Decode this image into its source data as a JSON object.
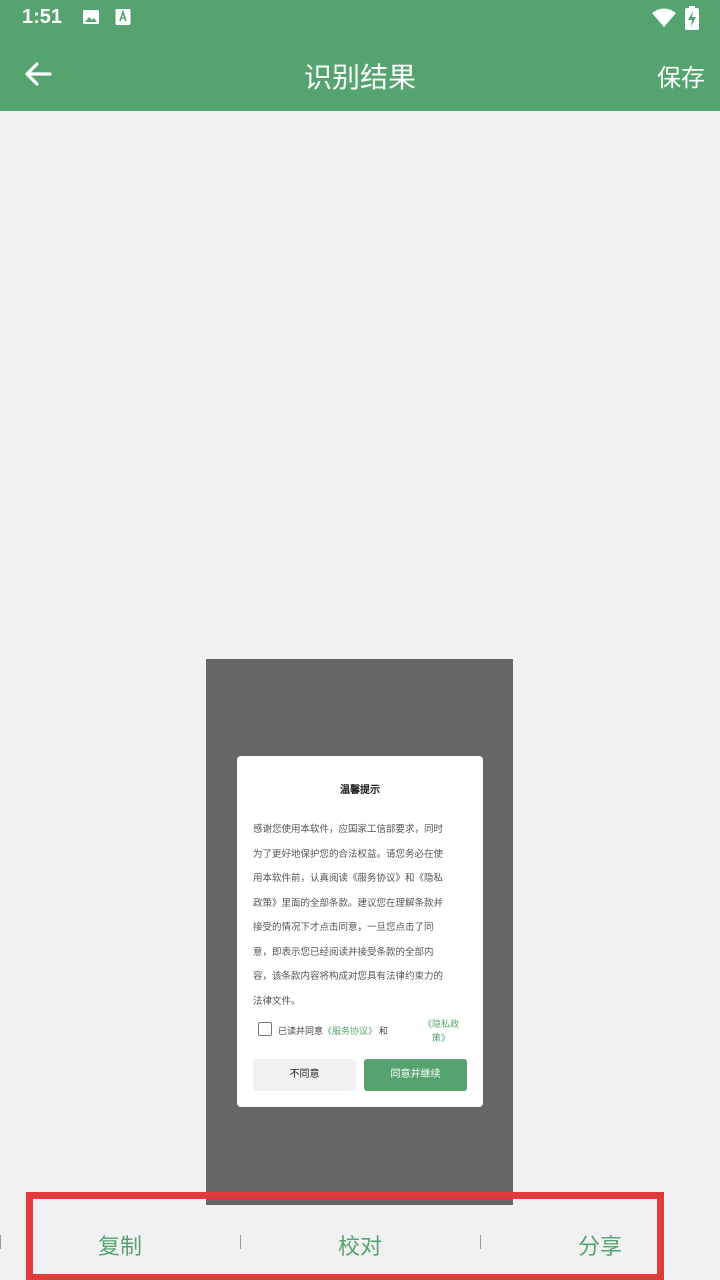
{
  "status_bar": {
    "time": "1:51",
    "icons": [
      "image-icon",
      "a-text-icon",
      "wifi-icon",
      "battery-charging-icon"
    ]
  },
  "app_bar": {
    "title": "识别结果",
    "save_label": "保存",
    "back_icon": "back-arrow-icon"
  },
  "preview_dialog": {
    "title": "温馨提示",
    "body_lines": [
      "感谢您使用本软件，应国家工信部要求，同时",
      "为了更好地保护您的合法权益。请您务必在使",
      "用本软件前，认真阅读《服务协议》和《隐私",
      "政策》里面的全部条款。建议您在理解条款并",
      "接受的情况下才点击同意，一旦您点击了同",
      "意，即表示您已经阅读并接受条款的全部内",
      "容，该条款内容将构成对您具有法律约束力的",
      "法律文件。"
    ],
    "consent_prefix": "已读并同意",
    "service_link": "《服务协议》",
    "and_text": "和",
    "privacy_link_line1": "《隐私政",
    "privacy_link_line2": "策》",
    "disagree_label": "不同意",
    "agree_label": "同意并继续"
  },
  "bottom_bar": {
    "copy_label": "复制",
    "proofread_label": "校对",
    "share_label": "分享"
  },
  "colors": {
    "primary_green": "#55a46f",
    "highlight_red": "#e03a3a",
    "background": "#f1f1f3",
    "preview_gray": "#666666"
  }
}
